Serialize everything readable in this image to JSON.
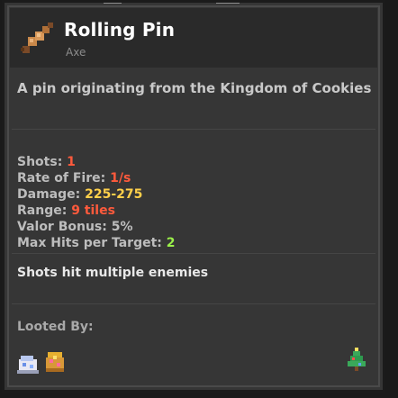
{
  "item": {
    "name": "Rolling Pin",
    "type": "Axe",
    "description": "A pin originating from the Kingdom of Cookies"
  },
  "stats": [
    {
      "label": "Shots: ",
      "value": "1",
      "value_color": "red"
    },
    {
      "label": "Rate of Fire: ",
      "value": "1/s",
      "value_color": "red"
    },
    {
      "label": "Damage: ",
      "value": "225-275",
      "value_color": "gold"
    },
    {
      "label": "Range: ",
      "value": "9 tiles",
      "value_color": "red"
    },
    {
      "label": "Valor Bonus: ",
      "value": "5%",
      "value_color": "default"
    },
    {
      "label": "Max Hits per Target: ",
      "value": "2",
      "value_color": "green"
    }
  ],
  "effect_text": "Shots hit multiple enemies",
  "looted_by": {
    "label": "Looted By:",
    "badges": [
      "cookie-cake-icon",
      "fruitcake-icon"
    ]
  },
  "corner_badge": "christmas-tree-icon",
  "colors": {
    "red": "#ff5a3c",
    "gold": "#ffd04a",
    "green": "#9aef4a",
    "panel": "#363636",
    "header": "#2a2a2a"
  }
}
